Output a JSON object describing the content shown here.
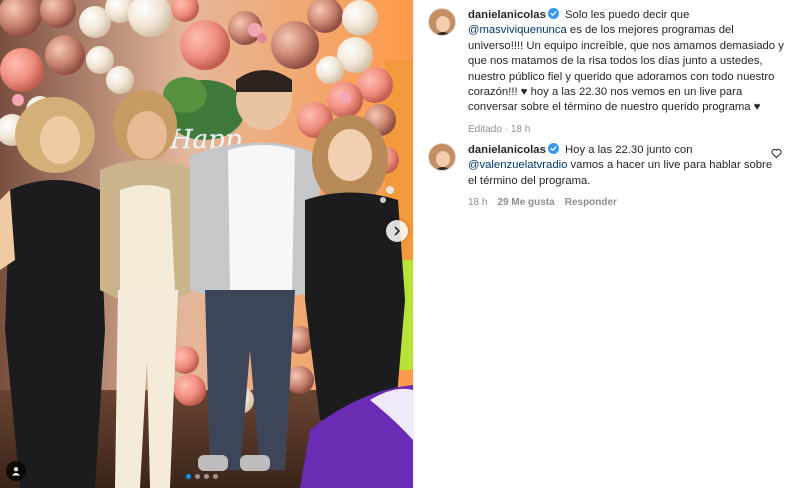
{
  "media": {
    "neon_sign": "Happy",
    "carousel": {
      "current": 1,
      "total": 4
    },
    "icons": {
      "next": "chevron-right-icon",
      "tagged_users": "user-icon"
    }
  },
  "caption": {
    "username": "danielanicolas",
    "text_intro": "Solo les puedo decir que ",
    "mention": "@masviviquenunca",
    "text_body": "es de los mejores programas del universo!!!! Un equipo increíble, que nos amamos demasiado y que nos matamos de la risa todos los días junto a ustedes, nuestro público fiel y querido que adoramos con todo nuestro corazón!!! ♥ hoy a las 22.30 nos vemos en un live para conversar sobre el término de nuestro querido programa ♥",
    "edited": "Editado",
    "time": "18 h"
  },
  "comment": {
    "username": "danielanicolas",
    "text_intro": "Hoy a las 22.30 junto con ",
    "mention": "@valenzuelatvradio",
    "text_body": "vamos a hacer un live para hablar sobre el término del programa.",
    "time": "18 h",
    "likes": "29 Me gusta",
    "reply": "Responder"
  },
  "colors": {
    "verified": "#3897f0",
    "mention": "#00376b",
    "meta": "#8e8e8e",
    "active_dot": "#0095f6"
  }
}
